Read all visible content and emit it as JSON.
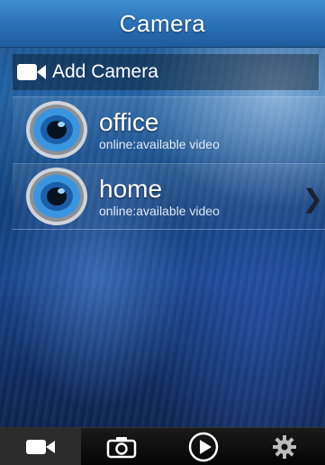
{
  "header": {
    "title": "Camera"
  },
  "add_camera": {
    "label": "Add Camera",
    "icon": "video-camera-icon"
  },
  "cameras": [
    {
      "name": "office",
      "status": "online:available video"
    },
    {
      "name": "home",
      "status": "online:available video"
    }
  ],
  "tab_bar": {
    "tabs": [
      {
        "icon": "video-camera-icon",
        "active": true
      },
      {
        "icon": "photo-camera-icon",
        "active": false
      },
      {
        "icon": "play-icon",
        "active": false
      },
      {
        "icon": "gear-icon",
        "active": false
      }
    ]
  },
  "colors": {
    "title_bar": "#2a6fb5",
    "tab_bar": "#050505",
    "lens_ring": "#3a95e0"
  }
}
